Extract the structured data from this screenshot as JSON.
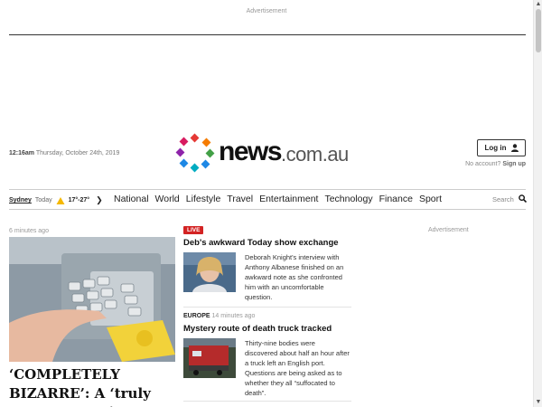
{
  "ads": {
    "top_label": "Advertisement",
    "right_label": "Advertisement"
  },
  "header": {
    "time": "12:16am",
    "date": "Thursday, October 24th, 2019",
    "logo_news": "news",
    "logo_domain": ".com.au",
    "login_label": "Log in",
    "no_account": "No account?",
    "sign_up": "Sign up"
  },
  "weather": {
    "city": "Sydney",
    "day": "Today",
    "temps": "17°-27°",
    "icon": "partly-sunny-icon"
  },
  "nav": {
    "items": [
      "National",
      "World",
      "Lifestyle",
      "Travel",
      "Entertainment",
      "Technology",
      "Finance",
      "Sport"
    ],
    "search_label": "Search"
  },
  "hero": {
    "time_ago": "6 minutes ago",
    "title": "‘COMPLETELY BIZARRE’: A ‘truly scary’ scenario"
  },
  "stories": [
    {
      "badge": "LIVE",
      "title": "Deb's awkward Today show exchange",
      "text": "Deborah Knight's interview with Anthony Albanese finished on an awkward note as she confronted him with an uncomfortable question."
    },
    {
      "section": "EUROPE",
      "time_ago": "14 minutes ago",
      "title": "Mystery route of death truck tracked",
      "text": "Thirty-nine bodies were discovered about half an hour after a truck left an English port. Questions are being asked as to whether they all “suffocated to death”."
    }
  ],
  "colors": {
    "live_red": "#d32323",
    "logo_dots": [
      "#e53935",
      "#f57c00",
      "#fbc02d",
      "#43a047",
      "#1e88e5",
      "#8e24aa",
      "#00acc1",
      "#d81b60"
    ]
  }
}
